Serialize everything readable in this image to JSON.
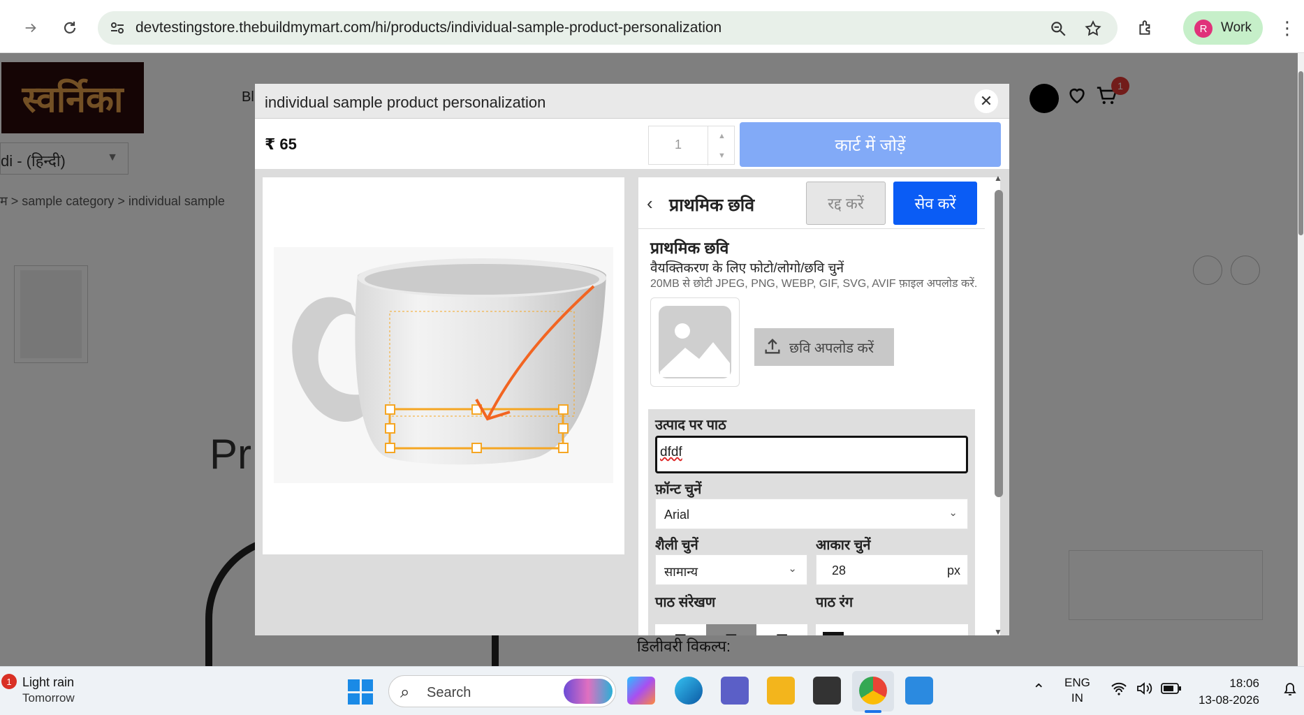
{
  "browser": {
    "url": "devtestingstore.thebuildmymart.com/hi/products/individual-sample-product-personalization",
    "profile_initial": "R",
    "profile_label": "Work"
  },
  "page": {
    "logo_text": "स्वर्निका",
    "language": "di - (हिन्दी)",
    "breadcrumb": "म  >  sample category  >  individual sample",
    "header_partial": "Bl",
    "cart_count": "1",
    "product_partial": "Pr",
    "delivery_label": "डिलीवरी विकल्प:"
  },
  "modal": {
    "title": "individual sample product personalization",
    "price": "₹ 65",
    "quantity": "1",
    "add_to_cart": "कार्ट में जोड़ें"
  },
  "editor": {
    "back_title": "प्राथमिक छवि",
    "cancel": "रद्द करें",
    "save": "सेव करें",
    "section_title": "प्राथमिक छवि",
    "section_desc": "वैयक्तिकरण के लिए फोटो/लोगो/छवि चुनें",
    "section_hint": "20MB से छोटी JPEG, PNG, WEBP, GIF, SVG, AVIF फ़ाइल अपलोड करें.",
    "upload_label": "छवि अपलोड करें",
    "text_label": "उत्पाद पर पाठ",
    "text_value": "dfdf",
    "font_label": "फ़ॉन्ट चुनें",
    "font_value": "Arial",
    "style_label": "शैली चुनें",
    "style_value": "सामान्य",
    "size_label": "आकार चुनें",
    "size_value": "28",
    "size_unit": "px",
    "align_label": "पाठ संरेखण",
    "align_active": "center",
    "color_label": "पाठ रंग",
    "color_value": "#111111"
  },
  "taskbar": {
    "weather_title": "Light rain",
    "weather_sub": "Tomorrow",
    "weather_badge": "1",
    "search_label": "Search",
    "lang_line1": "ENG",
    "lang_line2": "IN",
    "time": "18:06",
    "date": "13-08-2026"
  },
  "colors": {
    "accent_blue": "#0a5cf5",
    "add_cart_disabled": "#82aaf7",
    "selection_orange": "#f5a623",
    "arrow_orange": "#f26522"
  }
}
